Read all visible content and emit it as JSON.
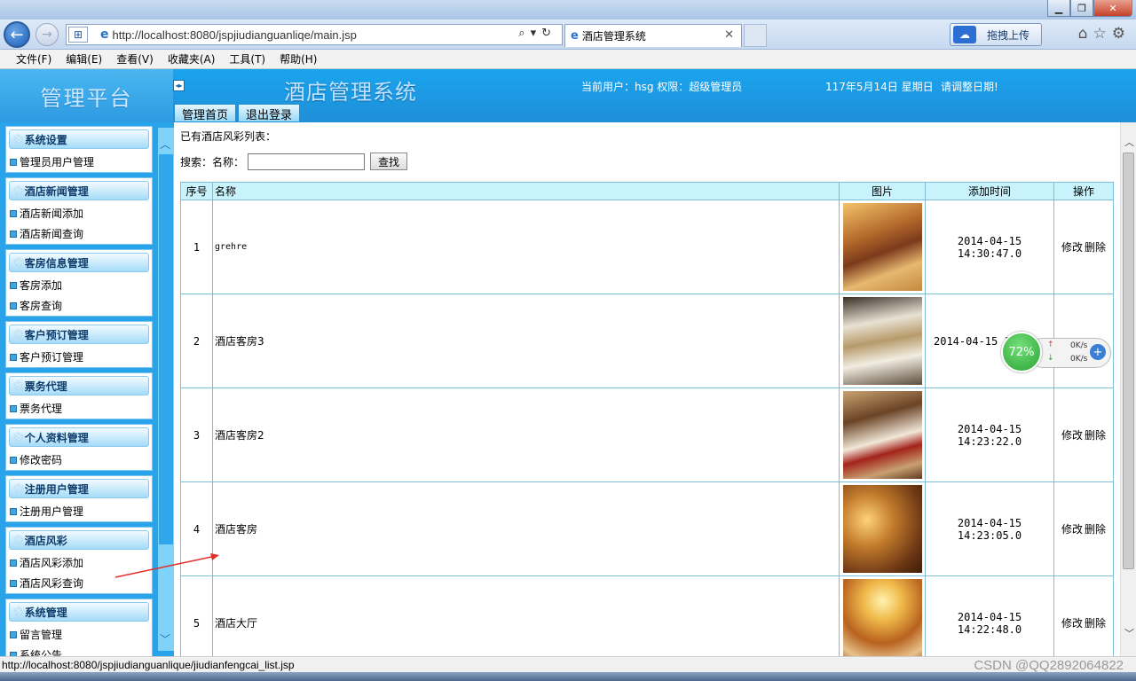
{
  "browser": {
    "url": "http://localhost:8080/jspjiudianguanliqe/main.jsp",
    "tab_title": "酒店管理系统",
    "upload_label": "拖拽上传",
    "menu": [
      "文件(F)",
      "编辑(E)",
      "查看(V)",
      "收藏夹(A)",
      "工具(T)",
      "帮助(H)"
    ],
    "status_url": "http://localhost:8080/jspjiudianguanlique/jiudianfengcai_list.jsp",
    "watermark": "CSDN @QQ2892064822"
  },
  "header": {
    "brand": "管理平台",
    "system_title": "酒店管理系统",
    "user_info": "当前用户：hsg  权限：超级管理员",
    "date": "117年5月14日  星期日",
    "adjust_date": "请调整日期!",
    "home_button": "管理首页",
    "logout_button": "退出登录"
  },
  "sidebar": {
    "groups": [
      {
        "title": "系统设置",
        "items": [
          "管理员用户管理"
        ]
      },
      {
        "title": "酒店新闻管理",
        "items": [
          "酒店新闻添加",
          "酒店新闻查询"
        ]
      },
      {
        "title": "客房信息管理",
        "items": [
          "客房添加",
          "客房查询"
        ]
      },
      {
        "title": "客户预订管理",
        "items": [
          "客户预订管理"
        ]
      },
      {
        "title": "票务代理",
        "items": [
          "票务代理"
        ]
      },
      {
        "title": "个人资料管理",
        "items": [
          "修改密码"
        ]
      },
      {
        "title": "注册用户管理",
        "items": [
          "注册用户管理"
        ]
      },
      {
        "title": "酒店风彩",
        "items": [
          "酒店风彩添加",
          "酒店风彩查询"
        ]
      },
      {
        "title": "系统管理",
        "items": [
          "留言管理",
          "系统公告"
        ]
      }
    ]
  },
  "main": {
    "list_title": "已有酒店风彩列表：",
    "search": {
      "label": "搜索：",
      "name_label": "名称：",
      "value": "",
      "button": "查找"
    },
    "columns": [
      "序号",
      "名称",
      "图片",
      "添加时间",
      "操作"
    ],
    "rows": [
      {
        "idx": "1",
        "name": "grehre",
        "time": "2014-04-15 14:30:47.0",
        "edit": "修改",
        "del": "删除"
      },
      {
        "idx": "2",
        "name": "酒店客房3",
        "time": "2014-04-15 14:",
        "edit": "",
        "del": ""
      },
      {
        "idx": "3",
        "name": "酒店客房2",
        "time": "2014-04-15 14:23:22.0",
        "edit": "修改",
        "del": "删除"
      },
      {
        "idx": "4",
        "name": "酒店客房",
        "time": "2014-04-15 14:23:05.0",
        "edit": "修改",
        "del": "删除"
      },
      {
        "idx": "5",
        "name": "酒店大厅",
        "time": "2014-04-15 14:22:48.0",
        "edit": "修改",
        "del": "删除"
      }
    ]
  },
  "net_widget": {
    "percent": "72%",
    "up": "0K/s",
    "down": "0K/s"
  }
}
